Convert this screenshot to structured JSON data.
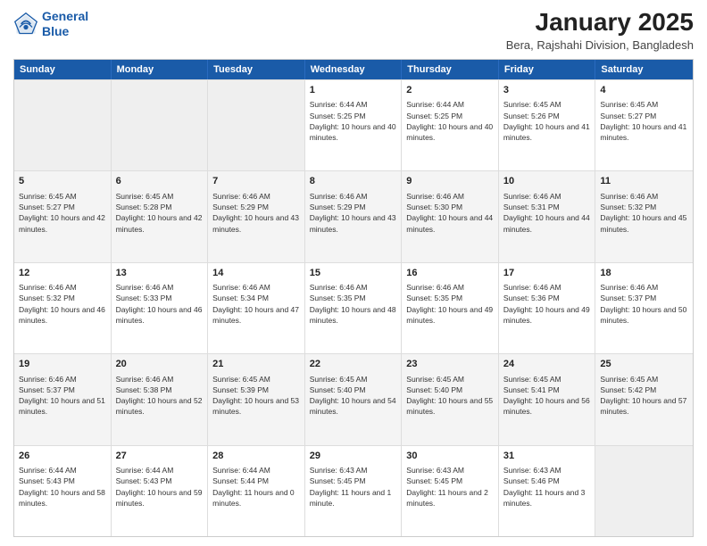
{
  "header": {
    "logo_line1": "General",
    "logo_line2": "Blue",
    "title": "January 2025",
    "subtitle": "Bera, Rajshahi Division, Bangladesh"
  },
  "days": [
    "Sunday",
    "Monday",
    "Tuesday",
    "Wednesday",
    "Thursday",
    "Friday",
    "Saturday"
  ],
  "weeks": [
    [
      {
        "num": "",
        "empty": true
      },
      {
        "num": "",
        "empty": true
      },
      {
        "num": "",
        "empty": true
      },
      {
        "num": "1",
        "sunrise": "6:44 AM",
        "sunset": "5:25 PM",
        "daylight": "10 hours and 40 minutes."
      },
      {
        "num": "2",
        "sunrise": "6:44 AM",
        "sunset": "5:25 PM",
        "daylight": "10 hours and 40 minutes."
      },
      {
        "num": "3",
        "sunrise": "6:45 AM",
        "sunset": "5:26 PM",
        "daylight": "10 hours and 41 minutes."
      },
      {
        "num": "4",
        "sunrise": "6:45 AM",
        "sunset": "5:27 PM",
        "daylight": "10 hours and 41 minutes."
      }
    ],
    [
      {
        "num": "5",
        "sunrise": "6:45 AM",
        "sunset": "5:27 PM",
        "daylight": "10 hours and 42 minutes."
      },
      {
        "num": "6",
        "sunrise": "6:45 AM",
        "sunset": "5:28 PM",
        "daylight": "10 hours and 42 minutes."
      },
      {
        "num": "7",
        "sunrise": "6:46 AM",
        "sunset": "5:29 PM",
        "daylight": "10 hours and 43 minutes."
      },
      {
        "num": "8",
        "sunrise": "6:46 AM",
        "sunset": "5:29 PM",
        "daylight": "10 hours and 43 minutes."
      },
      {
        "num": "9",
        "sunrise": "6:46 AM",
        "sunset": "5:30 PM",
        "daylight": "10 hours and 44 minutes."
      },
      {
        "num": "10",
        "sunrise": "6:46 AM",
        "sunset": "5:31 PM",
        "daylight": "10 hours and 44 minutes."
      },
      {
        "num": "11",
        "sunrise": "6:46 AM",
        "sunset": "5:32 PM",
        "daylight": "10 hours and 45 minutes."
      }
    ],
    [
      {
        "num": "12",
        "sunrise": "6:46 AM",
        "sunset": "5:32 PM",
        "daylight": "10 hours and 46 minutes."
      },
      {
        "num": "13",
        "sunrise": "6:46 AM",
        "sunset": "5:33 PM",
        "daylight": "10 hours and 46 minutes."
      },
      {
        "num": "14",
        "sunrise": "6:46 AM",
        "sunset": "5:34 PM",
        "daylight": "10 hours and 47 minutes."
      },
      {
        "num": "15",
        "sunrise": "6:46 AM",
        "sunset": "5:35 PM",
        "daylight": "10 hours and 48 minutes."
      },
      {
        "num": "16",
        "sunrise": "6:46 AM",
        "sunset": "5:35 PM",
        "daylight": "10 hours and 49 minutes."
      },
      {
        "num": "17",
        "sunrise": "6:46 AM",
        "sunset": "5:36 PM",
        "daylight": "10 hours and 49 minutes."
      },
      {
        "num": "18",
        "sunrise": "6:46 AM",
        "sunset": "5:37 PM",
        "daylight": "10 hours and 50 minutes."
      }
    ],
    [
      {
        "num": "19",
        "sunrise": "6:46 AM",
        "sunset": "5:37 PM",
        "daylight": "10 hours and 51 minutes."
      },
      {
        "num": "20",
        "sunrise": "6:46 AM",
        "sunset": "5:38 PM",
        "daylight": "10 hours and 52 minutes."
      },
      {
        "num": "21",
        "sunrise": "6:45 AM",
        "sunset": "5:39 PM",
        "daylight": "10 hours and 53 minutes."
      },
      {
        "num": "22",
        "sunrise": "6:45 AM",
        "sunset": "5:40 PM",
        "daylight": "10 hours and 54 minutes."
      },
      {
        "num": "23",
        "sunrise": "6:45 AM",
        "sunset": "5:40 PM",
        "daylight": "10 hours and 55 minutes."
      },
      {
        "num": "24",
        "sunrise": "6:45 AM",
        "sunset": "5:41 PM",
        "daylight": "10 hours and 56 minutes."
      },
      {
        "num": "25",
        "sunrise": "6:45 AM",
        "sunset": "5:42 PM",
        "daylight": "10 hours and 57 minutes."
      }
    ],
    [
      {
        "num": "26",
        "sunrise": "6:44 AM",
        "sunset": "5:43 PM",
        "daylight": "10 hours and 58 minutes."
      },
      {
        "num": "27",
        "sunrise": "6:44 AM",
        "sunset": "5:43 PM",
        "daylight": "10 hours and 59 minutes."
      },
      {
        "num": "28",
        "sunrise": "6:44 AM",
        "sunset": "5:44 PM",
        "daylight": "11 hours and 0 minutes."
      },
      {
        "num": "29",
        "sunrise": "6:43 AM",
        "sunset": "5:45 PM",
        "daylight": "11 hours and 1 minute."
      },
      {
        "num": "30",
        "sunrise": "6:43 AM",
        "sunset": "5:45 PM",
        "daylight": "11 hours and 2 minutes."
      },
      {
        "num": "31",
        "sunrise": "6:43 AM",
        "sunset": "5:46 PM",
        "daylight": "11 hours and 3 minutes."
      },
      {
        "num": "",
        "empty": true
      }
    ]
  ]
}
